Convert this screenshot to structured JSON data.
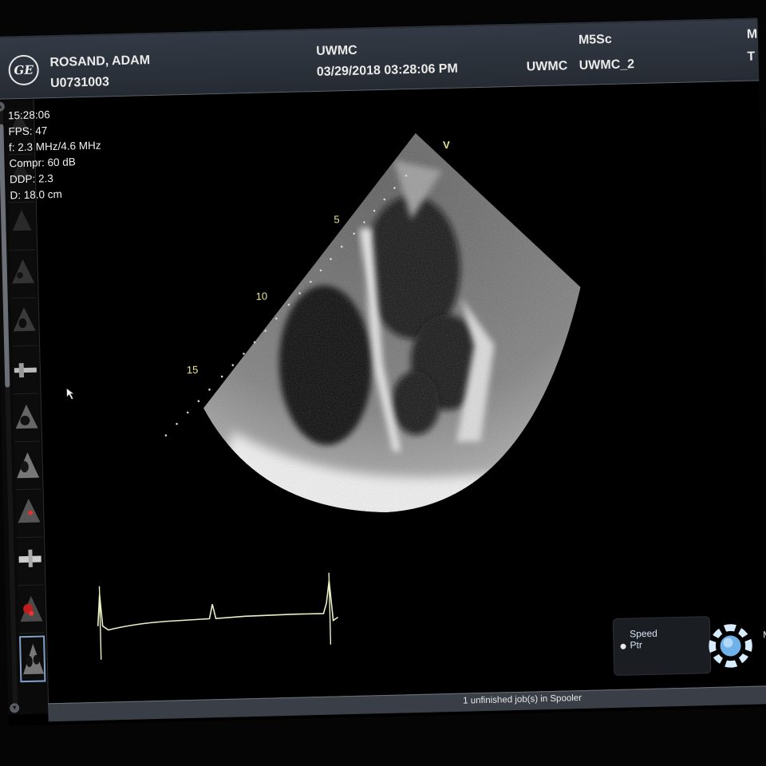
{
  "header": {
    "patient_name": "ROSAND, ADAM",
    "patient_id": "U0731003",
    "institution": "UWMC",
    "datetime": "03/29/2018 03:28:06 PM",
    "station": "UWMC",
    "station_id": "UWMC_2",
    "probe": "M5Sc",
    "right_cut_top": "M",
    "right_cut_bottom": "T",
    "logo_text": "GE"
  },
  "params": {
    "time": "15:28:06",
    "fps": "FPS: 47",
    "freq": "f: 2.3 MHz/4.6 MHz",
    "compr": "Compr: 60 dB",
    "ddp": "DDP: 2.3",
    "depth": "D: 18.0 cm"
  },
  "image": {
    "orientation_marker": "V",
    "depth_5": "5",
    "depth_10": "10",
    "depth_15": "15"
  },
  "controls": {
    "speed_label": "Speed",
    "ptr_label": "Ptr",
    "right_cut": "M"
  },
  "status": {
    "spooler": "1 unfinished job(s) in Spooler"
  },
  "icons": [
    "ge-logo-icon",
    "trackball-icon",
    "cursor-arrow-icon",
    "scroll-up-icon",
    "scroll-down-icon"
  ],
  "colors": {
    "depth_markers": "#e8e48a",
    "ecg_trace": "#e9f2c6",
    "header_bg": "#2c323b"
  }
}
